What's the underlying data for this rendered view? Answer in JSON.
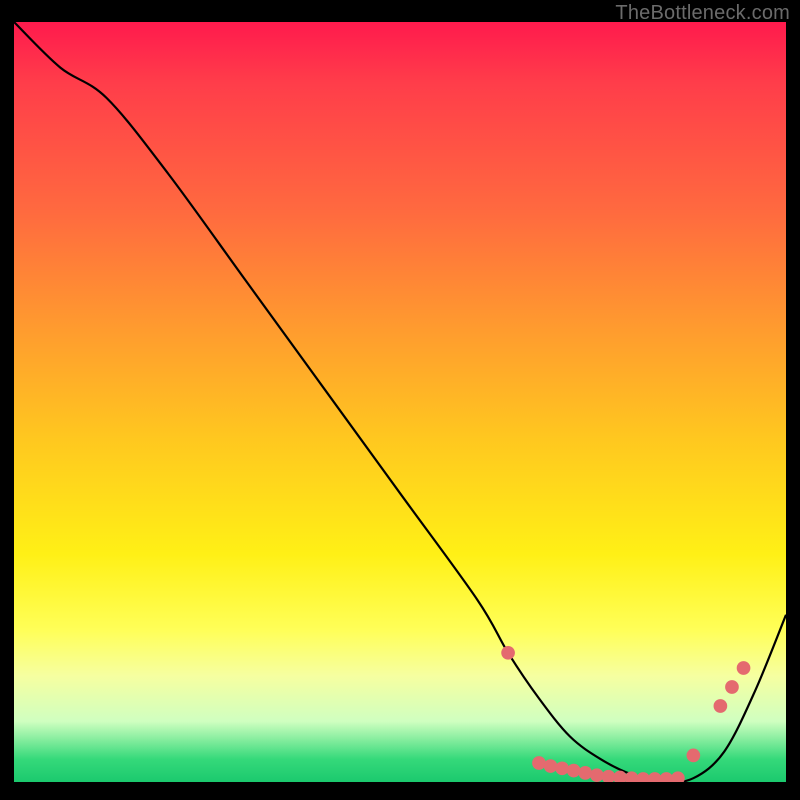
{
  "watermark": "TheBottleneck.com",
  "chart_data": {
    "type": "line",
    "title": "",
    "xlabel": "",
    "ylabel": "",
    "xlim": [
      0,
      100
    ],
    "ylim": [
      0,
      100
    ],
    "grid": false,
    "series": [
      {
        "name": "bottleneck-curve",
        "color": "#000000",
        "x": [
          0,
          6,
          12,
          20,
          30,
          40,
          50,
          60,
          64,
          68,
          72,
          76,
          80,
          84,
          88,
          92,
          96,
          100
        ],
        "y": [
          100,
          94,
          90,
          80,
          66,
          52,
          38,
          24,
          17,
          11,
          6,
          3,
          1,
          0,
          0.5,
          4,
          12,
          22
        ]
      }
    ],
    "markers": {
      "color": "#e46a6f",
      "radius_frac": 0.009,
      "points": [
        {
          "x": 64,
          "y": 17
        },
        {
          "x": 68,
          "y": 2.5
        },
        {
          "x": 69.5,
          "y": 2.1
        },
        {
          "x": 71,
          "y": 1.8
        },
        {
          "x": 72.5,
          "y": 1.5
        },
        {
          "x": 74,
          "y": 1.2
        },
        {
          "x": 75.5,
          "y": 0.9
        },
        {
          "x": 77,
          "y": 0.7
        },
        {
          "x": 78.5,
          "y": 0.6
        },
        {
          "x": 80,
          "y": 0.5
        },
        {
          "x": 81.5,
          "y": 0.4
        },
        {
          "x": 83,
          "y": 0.4
        },
        {
          "x": 84.5,
          "y": 0.4
        },
        {
          "x": 86,
          "y": 0.5
        },
        {
          "x": 88,
          "y": 3.5
        },
        {
          "x": 91.5,
          "y": 10
        },
        {
          "x": 93,
          "y": 12.5
        },
        {
          "x": 94.5,
          "y": 15
        }
      ]
    }
  }
}
